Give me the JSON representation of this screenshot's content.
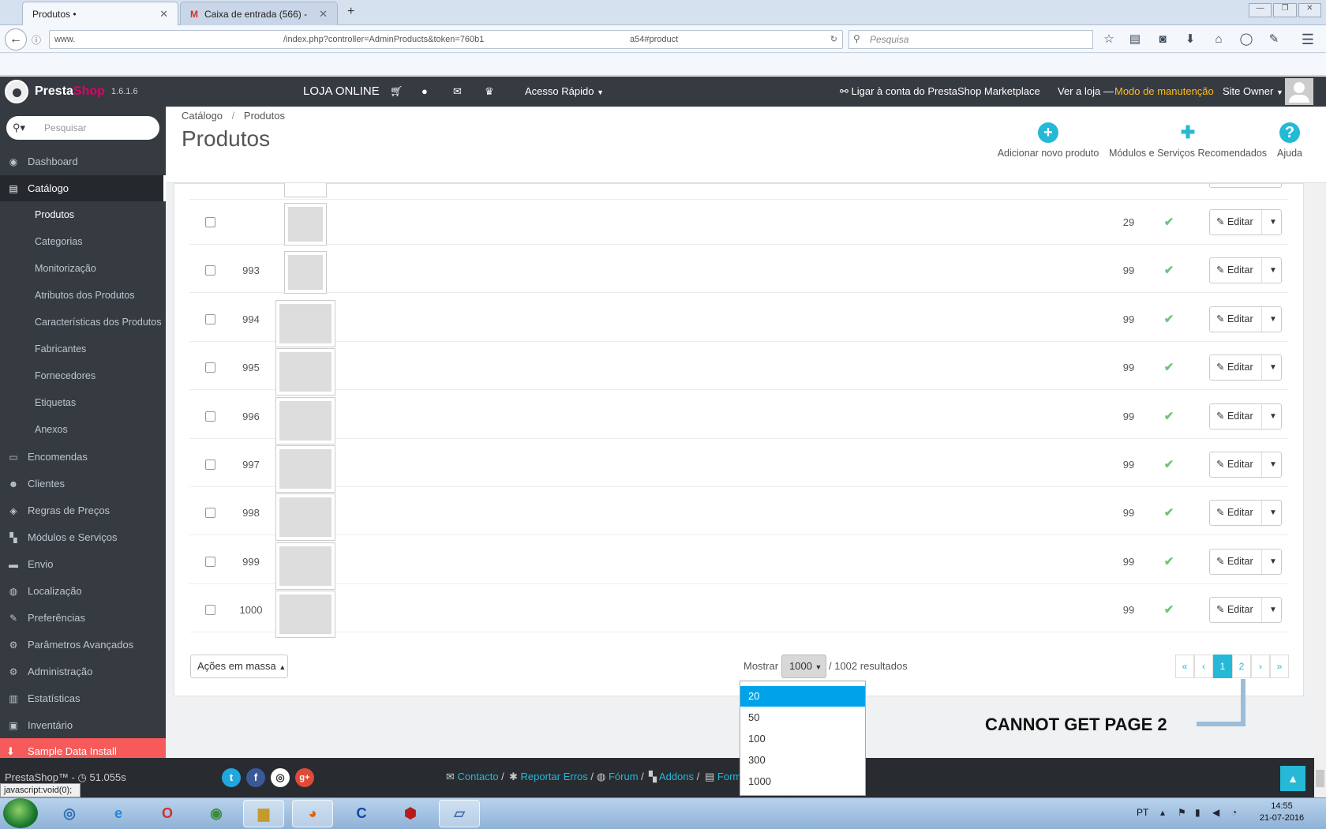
{
  "browser": {
    "tabs": [
      {
        "title": "Produtos •",
        "close": "✕"
      },
      {
        "title": "Caixa de entrada (566) -",
        "close": "✕"
      }
    ],
    "new_tab": "+",
    "url_left": "www.",
    "url_mid": "/index.php?controller=AdminProducts&token=760b1",
    "url_right": "a54#product",
    "search_placeholder": "Pesquisa",
    "window_controls": [
      "—",
      "❐",
      "✕"
    ]
  },
  "header": {
    "logo_main": "Presta",
    "logo_accent": "Shop",
    "version": "1.6.1.6",
    "store_name": "LOJA ONLINE",
    "quick_access": "Acesso Rápido",
    "marketplace": "Ligar à conta do PrestaShop Marketplace",
    "view_store": "Ver a loja",
    "separator": "—",
    "maintenance": "Modo de manutenção",
    "user": "Site Owner"
  },
  "sidebar": {
    "search_placeholder": "Pesquisar",
    "items": [
      {
        "label": "Dashboard",
        "icon": "◉"
      },
      {
        "label": "Catálogo",
        "icon": "▤"
      },
      {
        "label": "Encomendas",
        "icon": "▭"
      },
      {
        "label": "Clientes",
        "icon": "☻"
      },
      {
        "label": "Regras de Preços",
        "icon": "◈"
      },
      {
        "label": "Módulos e Serviços",
        "icon": "▚"
      },
      {
        "label": "Envio",
        "icon": "▬"
      },
      {
        "label": "Localização",
        "icon": "◍"
      },
      {
        "label": "Preferências",
        "icon": "✎"
      },
      {
        "label": "Parâmetros Avançados",
        "icon": "⚙"
      },
      {
        "label": "Administração",
        "icon": "⚙"
      },
      {
        "label": "Estatísticas",
        "icon": "▥"
      },
      {
        "label": "Inventário",
        "icon": "▣"
      }
    ],
    "catalog_sub": [
      "Produtos",
      "Categorias",
      "Monitorização",
      "Atributos dos Produtos",
      "Características dos Produtos",
      "Fabricantes",
      "Fornecedores",
      "Etiquetas",
      "Anexos"
    ],
    "sample_data": "Sample Data Install"
  },
  "page": {
    "breadcrumb_parent": "Catálogo",
    "breadcrumb_sep": "/",
    "breadcrumb_current": "Produtos",
    "title": "Produtos",
    "toolbar": [
      {
        "label": "Adicionar novo produto",
        "icon": "+"
      },
      {
        "label": "Módulos e Serviços Recomendados",
        "icon": "✚"
      },
      {
        "label": "Ajuda",
        "icon": "?"
      }
    ]
  },
  "table": {
    "edit_label": "Editar",
    "check_mark": "✔",
    "rows": [
      {
        "id": "",
        "qty": "29"
      },
      {
        "id": "993",
        "qty": "99"
      },
      {
        "id": "994",
        "qty": "99"
      },
      {
        "id": "995",
        "qty": "99"
      },
      {
        "id": "996",
        "qty": "99"
      },
      {
        "id": "997",
        "qty": "99"
      },
      {
        "id": "998",
        "qty": "99"
      },
      {
        "id": "999",
        "qty": "99"
      },
      {
        "id": "1000",
        "qty": "99"
      }
    ]
  },
  "footer_controls": {
    "bulk_actions": "Ações em massa",
    "show_label": "Mostrar",
    "per_page": "1000",
    "results": "/ 1002 resultados",
    "pagination": [
      "«",
      "‹",
      "1",
      "2",
      "›",
      "»"
    ],
    "per_page_options": [
      "20",
      "50",
      "100",
      "300",
      "1000"
    ],
    "annotation": "CANNOT GET PAGE 2"
  },
  "ps_footer": {
    "left": "PrestaShop™ - ◷ 51.055s",
    "links": [
      "Contacto",
      "Reportar Erros",
      "Fórum",
      "Addons",
      "Form"
    ],
    "social": [
      "t",
      "f",
      "◎",
      "g+"
    ]
  },
  "status_bar": "javascript:void(0);",
  "taskbar": {
    "lang": "PT",
    "time": "14:55",
    "date": "21-07-2016"
  },
  "colors": {
    "accent": "#25b9d7",
    "sidebar": "#363a41",
    "danger": "#f75a5a",
    "maintenance": "#fbbb22"
  }
}
